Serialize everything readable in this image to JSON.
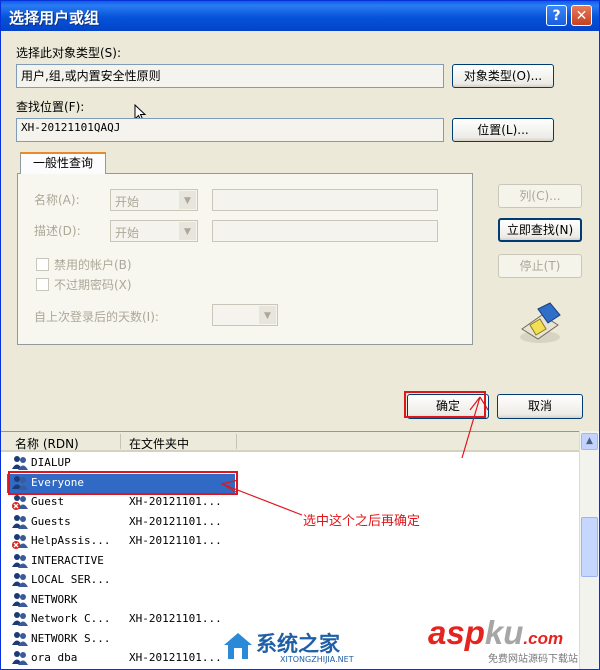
{
  "window": {
    "title": "选择用户或组"
  },
  "object_type": {
    "label": "选择此对象类型(S):",
    "value": "用户,组,或内置安全性原则",
    "button": "对象类型(O)..."
  },
  "location": {
    "label": "查找位置(F):",
    "value": "XH-20121101QAQJ",
    "button": "位置(L)..."
  },
  "query_tab": {
    "tab_label": "一般性查询",
    "name_label": "名称(A):",
    "name_combo": "开始",
    "desc_label": "描述(D):",
    "desc_combo": "开始",
    "disabled_accounts": "禁用的帐户(B)",
    "non_expiring": "不过期密码(X)",
    "days_label": "自上次登录后的天数(I):"
  },
  "side_buttons": {
    "columns": "列(C)...",
    "find_now": "立即查找(N)",
    "stop": "停止(T)"
  },
  "footer_buttons": {
    "ok": "确定",
    "cancel": "取消"
  },
  "results": {
    "columns": [
      "名称 (RDN)",
      "在文件夹中"
    ],
    "rows": [
      {
        "name": "DIALUP",
        "folder": ""
      },
      {
        "name": "Everyone",
        "folder": ""
      },
      {
        "name": "Guest",
        "folder": "XH-20121101..."
      },
      {
        "name": "Guests",
        "folder": "XH-20121101..."
      },
      {
        "name": "HelpAssis...",
        "folder": "XH-20121101..."
      },
      {
        "name": "INTERACTIVE",
        "folder": ""
      },
      {
        "name": "LOCAL SER...",
        "folder": ""
      },
      {
        "name": "NETWORK",
        "folder": ""
      },
      {
        "name": "Network C...",
        "folder": "XH-20121101..."
      },
      {
        "name": "NETWORK S...",
        "folder": ""
      },
      {
        "name": "ora dba",
        "folder": "XH-20121101..."
      }
    ]
  },
  "annotation": {
    "text": "选中这个之后再确定"
  },
  "watermarks": {
    "left_brand": "系统之家",
    "left_url": "XITONGZHIJIA.NET",
    "right_brand_a": "asp",
    "right_brand_b": "ku",
    "right_brand_c": ".com",
    "right_tagline": "免费网站源码下载站"
  },
  "colors": {
    "titlebar": "#0453d8",
    "selection": "#316ac5",
    "annotation_red": "#e0161b"
  }
}
